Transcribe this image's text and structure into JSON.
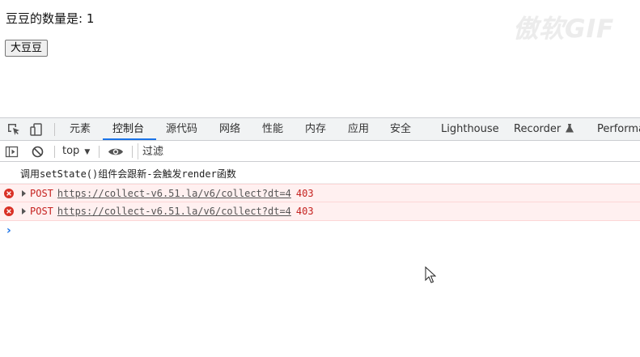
{
  "page": {
    "count_text": "豆豆的数量是: 1",
    "big_bean_button": "大豆豆",
    "watermark": "傲软GIF"
  },
  "devtools": {
    "tabs": [
      {
        "label": "元素"
      },
      {
        "label": "控制台"
      },
      {
        "label": "源代码"
      },
      {
        "label": "网络"
      },
      {
        "label": "性能"
      },
      {
        "label": "内存"
      },
      {
        "label": "应用"
      },
      {
        "label": "安全"
      },
      {
        "label": "Lighthouse"
      },
      {
        "label": "Recorder"
      },
      {
        "label": "Performa"
      }
    ],
    "active_tab": "控制台",
    "toolbar": {
      "context": "top",
      "filter_placeholder": "过滤"
    },
    "console": {
      "log_message": "调用setState()组件会跟新-会触发render函数",
      "errors": [
        {
          "method": "POST",
          "url": "https://collect-v6.51.la/v6/collect?dt=4",
          "status": "403"
        },
        {
          "method": "POST",
          "url": "https://collect-v6.51.la/v6/collect?dt=4",
          "status": "403"
        }
      ],
      "prompt": "›"
    },
    "colors": {
      "accent": "#1a73e8",
      "error_text": "#c5221f",
      "error_bg": "#fff0f0"
    }
  }
}
